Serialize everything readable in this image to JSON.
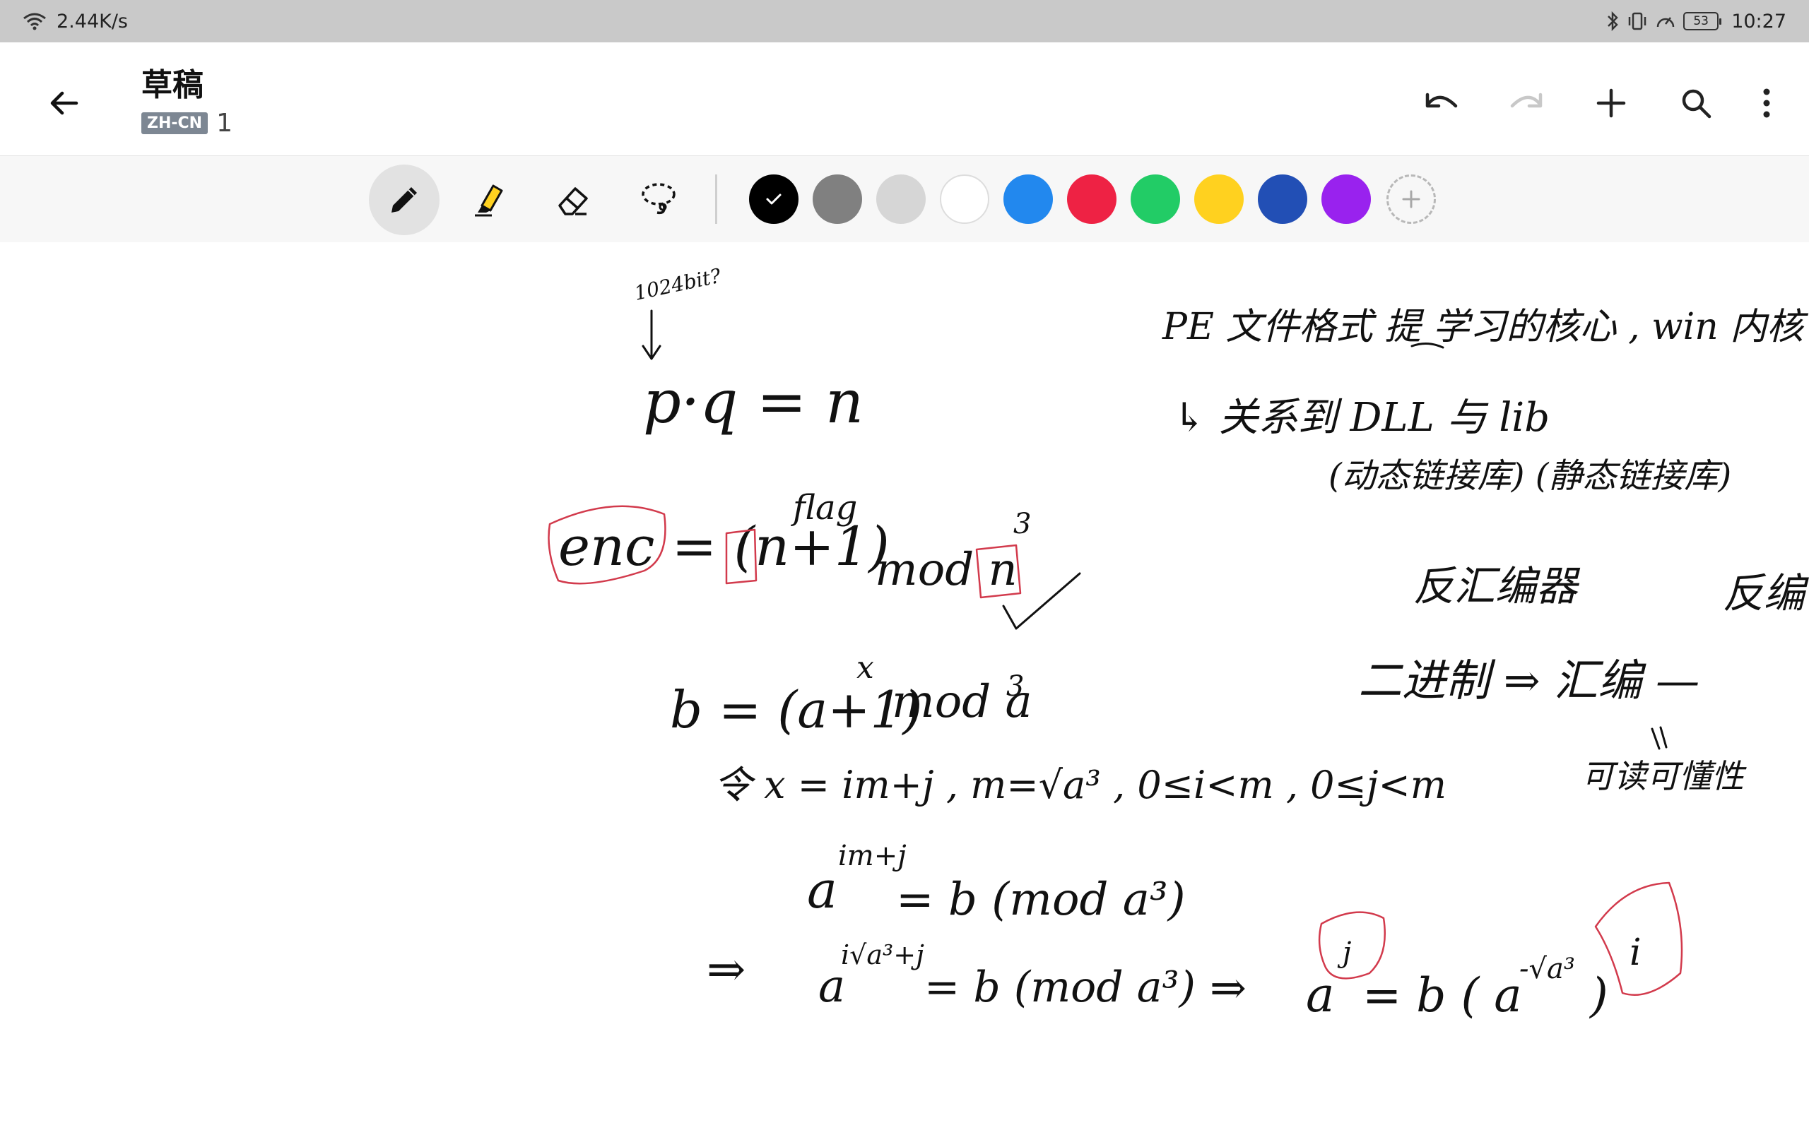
{
  "status_bar": {
    "network_speed": "2.44K/s",
    "battery_level": "53",
    "time": "10:27",
    "icons": [
      "wifi-icon",
      "bluetooth-icon",
      "vibrate-icon",
      "speed-icon",
      "battery-icon"
    ]
  },
  "app_bar": {
    "title": "草稿",
    "language_tag": "ZH-CN",
    "page_number": "1",
    "actions": [
      "back-icon",
      "undo-icon",
      "redo-icon",
      "add-icon",
      "search-icon",
      "more-icon"
    ]
  },
  "toolbar": {
    "tools": [
      "pen",
      "highlighter",
      "eraser",
      "lasso"
    ],
    "active_tool": "pen",
    "colors": [
      "#000000",
      "#808080",
      "#d6d6d6",
      "#ffffff",
      "#2288ee",
      "#ee2244",
      "#22cc66",
      "#ffd11f",
      "#224fb5",
      "#9922ee"
    ],
    "selected_color": "#000000"
  },
  "canvas_notes": {
    "bits_note": "1024bit?",
    "rsa_eq": "p·q = n",
    "enc_eq": "enc = (n+1)",
    "enc_exp": "flag",
    "enc_mod": "mod n",
    "enc_mod_exp": "3",
    "b_eq": "b = (a+1)",
    "b_exp": "x",
    "b_mod": "mod a",
    "b_mod_exp": "3",
    "let_eq": "令 x = im+j , m=√a³ , 0≤i<m , 0≤j<m",
    "a_eq": "a",
    "a_exp": "im+j",
    "a_rhs": "= b (mod a³)",
    "implies_1": "⇒",
    "a2_exp": "i√a³+j",
    "a2_rhs": "= b (mod a³)",
    "implies_2": "⇒",
    "a3_rhs": "= b ( a",
    "a3_exp": "-√a³",
    "a3_close": ")",
    "a3_i": "i",
    "pe_note": "PE 文件格式 提 学习的核心 , win 内核 API",
    "dll_note": "↳ 关系到 DLL 与 lib",
    "link_note": "(动态链接库)  (静态链接库)",
    "disasm_1": "反汇编器",
    "disasm_2": "反编",
    "binary_flow": "二进制 ⇒ 汇编 —",
    "readable_note": "可读可懂性"
  }
}
